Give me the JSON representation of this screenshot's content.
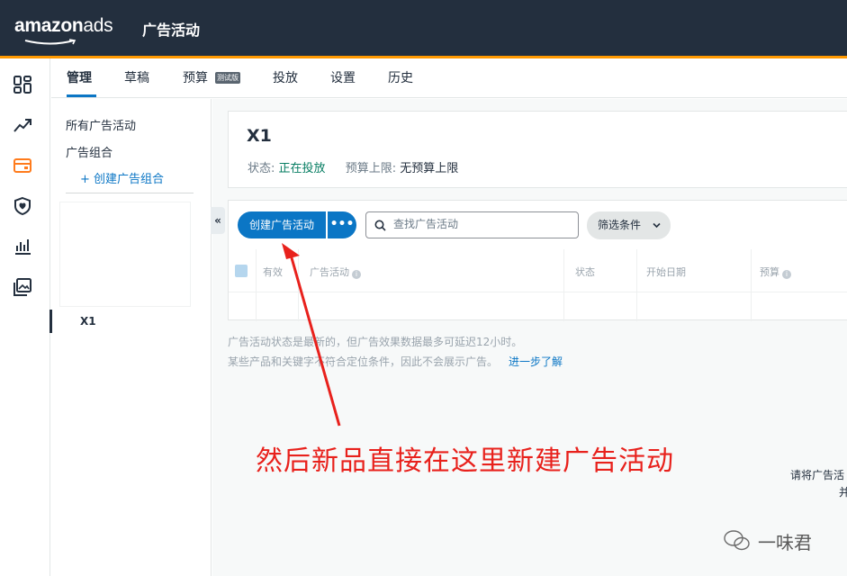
{
  "header": {
    "logo": {
      "part1": "amazon",
      "part2": "ads"
    },
    "title": "广告活动"
  },
  "rail": {
    "icons": [
      "dashboard-icon",
      "trend-chart-icon",
      "campaigns-icon",
      "shield-icon",
      "bar-chart-icon",
      "media-library-icon"
    ],
    "active": "campaigns-icon"
  },
  "tabs": {
    "items": [
      {
        "label": "管理",
        "active": true
      },
      {
        "label": "草稿"
      },
      {
        "label": "预算",
        "badge": "测试版"
      },
      {
        "label": "投放"
      },
      {
        "label": "设置"
      },
      {
        "label": "历史"
      }
    ]
  },
  "subnav": {
    "all_campaigns": "所有广告活动",
    "portfolios": "广告组合",
    "create_portfolio": "+ 创建广告组合",
    "portfolio_item": "X1"
  },
  "summary": {
    "name": "X1",
    "status_label": "状态:",
    "status_value": "正在投放",
    "budget_label": "预算上限:",
    "budget_value": "无预算上限"
  },
  "toolbar": {
    "create_label": "创建广告活动",
    "more_label": "•••",
    "search_placeholder": "查找广告活动",
    "filter_label": "筛选条件"
  },
  "table": {
    "columns": [
      "有效",
      "广告活动",
      "状态",
      "开始日期",
      "预算"
    ]
  },
  "notes": {
    "line1": "广告活动状态是最新的，但广告效果数据最多可延迟12小时。",
    "line2": "某些产品和关键字不符合定位条件，因此不会展示广告。",
    "link": "进一步了解"
  },
  "annotation": {
    "text": "然后新品直接在这里新建广告活动",
    "color": "#e8211c"
  },
  "edge_text": {
    "line1": "请将广告活",
    "line2": "并"
  },
  "watermark": "一味君",
  "colors": {
    "header": "#232f3e",
    "accent": "#ff9900",
    "primary": "#0b76c5"
  }
}
